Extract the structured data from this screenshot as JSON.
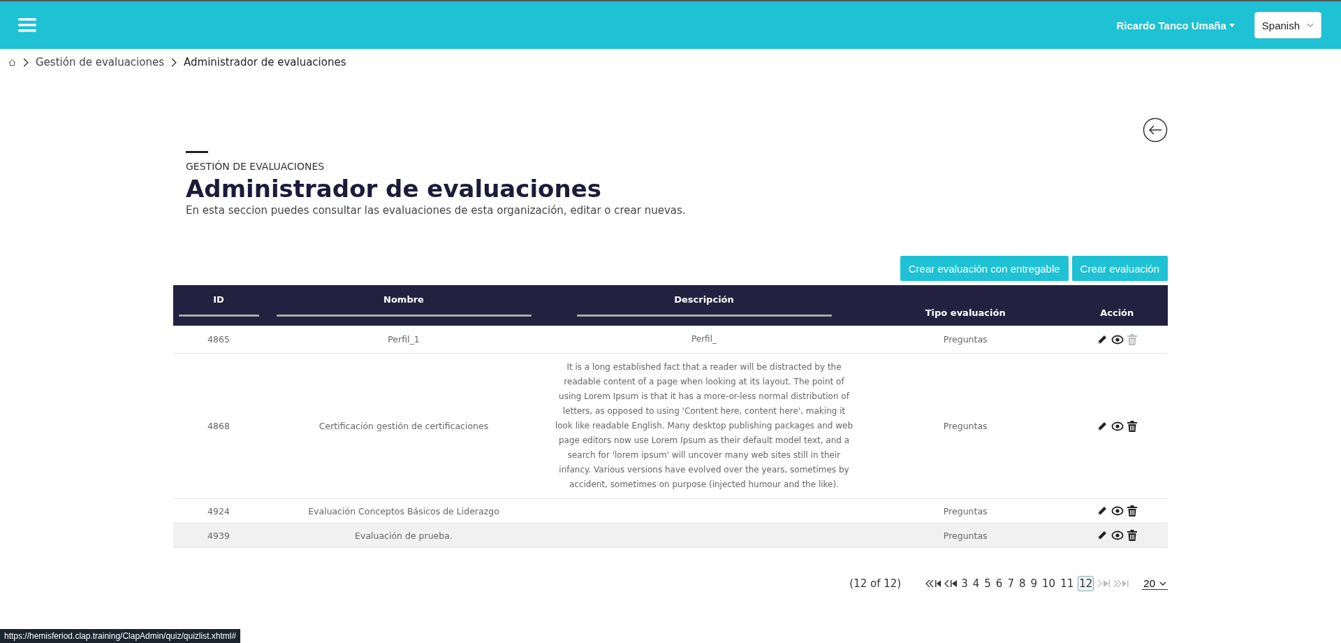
{
  "header": {
    "user": "Ricardo Tanco Umaña",
    "language": "Spanish"
  },
  "breadcrumb": [
    "Gestión de evaluaciones",
    "Administrador de evaluaciones"
  ],
  "page": {
    "eyebrow": "GESTIÓN DE EVALUACIONES",
    "title": "Administrador de evaluaciones",
    "description": "En esta seccion puedes consultar las evaluaciones de esta organización, editar o crear nuevas."
  },
  "buttons": [
    "Crear evaluación con entregable",
    "Crear evaluación"
  ],
  "table": {
    "columns": [
      {
        "label": "ID",
        "filter": true
      },
      {
        "label": "Nombre",
        "filter": true
      },
      {
        "label": "Descripción",
        "filter": true
      },
      {
        "label": "Tipo evaluación",
        "filter": false
      },
      {
        "label": "Acción",
        "filter": false
      }
    ],
    "rows": [
      {
        "id": "4865",
        "name": "Perfil_1",
        "description": "Perfil_",
        "type": "Preguntas",
        "delete_enabled": false,
        "hovered": false
      },
      {
        "id": "4868",
        "name": "Certificación gestión de certificaciones",
        "description": "It is a long established fact that a reader will be distracted by the readable content of a page when looking at its layout. The point of using Lorem Ipsum is that it has a more-or-less normal distribution of letters, as opposed to using 'Content here, content here', making it look like readable English. Many desktop publishing packages and web page editors now use Lorem Ipsum as their default model text, and a search for 'lorem ipsum' will uncover many web sites still in their infancy. Various versions have evolved over the years, sometimes by accident, sometimes on purpose (injected humour and the like).",
        "type": "Preguntas",
        "delete_enabled": true,
        "hovered": false
      },
      {
        "id": "4924",
        "name": "Evaluación Conceptos Básicos de Liderazgo",
        "description": "",
        "type": "Preguntas",
        "delete_enabled": true,
        "hovered": false
      },
      {
        "id": "4939",
        "name": "Evaluación de prueba.",
        "description": "",
        "type": "Preguntas",
        "delete_enabled": true,
        "hovered": true
      }
    ]
  },
  "paginator": {
    "summary": "(12 of 12)",
    "first_disabled": false,
    "prev_disabled": false,
    "next_disabled": true,
    "last_disabled": true,
    "pages": [
      {
        "label": "3",
        "selected": false
      },
      {
        "label": "4",
        "selected": false
      },
      {
        "label": "5",
        "selected": false
      },
      {
        "label": "6",
        "selected": false
      },
      {
        "label": "7",
        "selected": false
      },
      {
        "label": "8",
        "selected": false
      },
      {
        "label": "9",
        "selected": false
      },
      {
        "label": "10",
        "selected": false
      },
      {
        "label": "11",
        "selected": false
      },
      {
        "label": "12",
        "selected": true
      }
    ],
    "rows_per_page": "20"
  },
  "status_url": "https://hemisferiod.clap.training/ClapAdmin/quiz/quizlist.xhtml#"
}
